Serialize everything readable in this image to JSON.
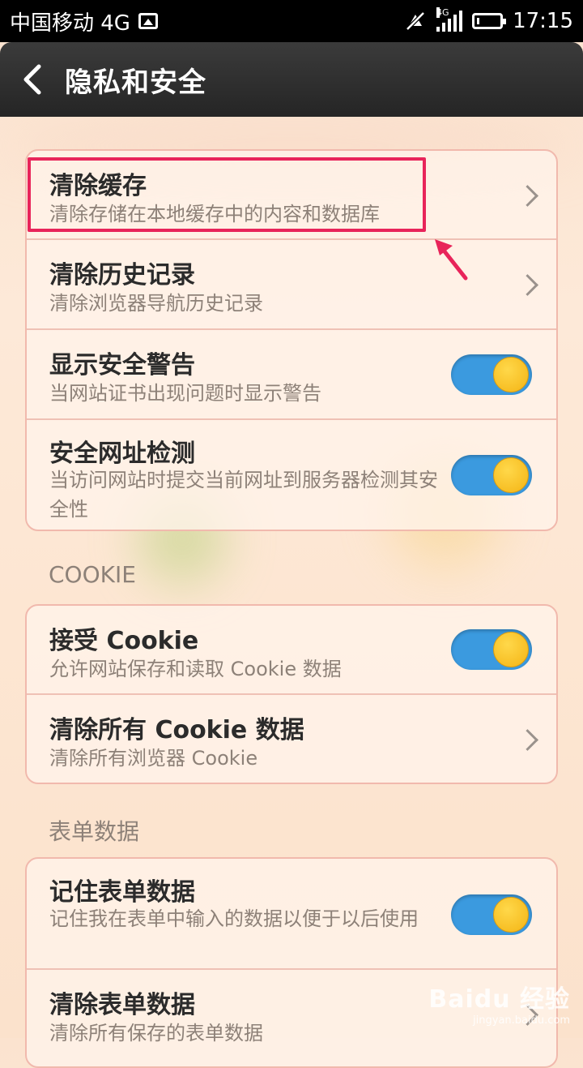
{
  "status_bar": {
    "carrier": "中国移动 4G",
    "network": "4G",
    "time": "17:15",
    "icons": [
      "gallery-icon",
      "mute-icon",
      "signal-icon",
      "battery-icon"
    ]
  },
  "header": {
    "title": "隐私和安全",
    "back_icon": "back-arrow-icon"
  },
  "privacy_card": {
    "rows": [
      {
        "title": "清除缓存",
        "subtitle": "清除存储在本地缓存中的内容和数据库",
        "control": "chevron"
      },
      {
        "title": "清除历史记录",
        "subtitle": "清除浏览器导航历史记录",
        "control": "chevron"
      },
      {
        "title": "显示安全警告",
        "subtitle": "当网站证书出现问题时显示警告",
        "control": "toggle",
        "toggle_on": true
      },
      {
        "title": "安全网址检测",
        "subtitle": "当访问网站时提交当前网址到服务器检测其安全性",
        "control": "toggle",
        "toggle_on": true
      }
    ]
  },
  "cookie_section": {
    "label": "COOKIE",
    "rows": [
      {
        "title": "接受 Cookie",
        "subtitle": "允许网站保存和读取 Cookie 数据",
        "control": "toggle",
        "toggle_on": true
      },
      {
        "title": "清除所有 Cookie 数据",
        "subtitle": "清除所有浏览器 Cookie",
        "control": "chevron"
      }
    ]
  },
  "form_section": {
    "label": "表单数据",
    "rows": [
      {
        "title": "记住表单数据",
        "subtitle": "记住我在表单中输入的数据以便于以后使用",
        "control": "toggle",
        "toggle_on": true
      },
      {
        "title": "清除表单数据",
        "subtitle": "清除所有保存的表单数据",
        "control": "chevron"
      }
    ]
  },
  "annotation": {
    "highlight_color": "#e8245a",
    "target": "清除缓存"
  },
  "colors": {
    "toggle_track": "#3b9adf",
    "toggle_knob": "#f4b414",
    "card_border": "#f1b9ad",
    "header_bg": "#2c2c2c"
  },
  "watermark": {
    "brand": "Baidu 经验",
    "url": "jingyan.baidu.com"
  }
}
